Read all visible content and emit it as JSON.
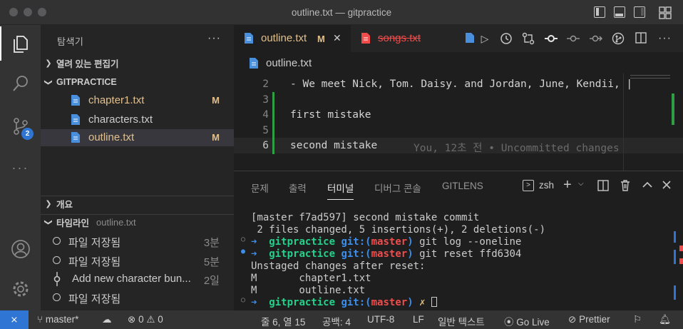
{
  "window": {
    "title": "outline.txt — gitpractice"
  },
  "activity": {
    "scm_badge": "2"
  },
  "sidebar": {
    "title": "탐색기",
    "more": "···",
    "open_editors": "열려 있는 편집기",
    "folder": "GITPRACTICE",
    "files": [
      {
        "name": "chapter1.txt",
        "status": "M"
      },
      {
        "name": "characters.txt",
        "status": ""
      },
      {
        "name": "outline.txt",
        "status": "M"
      }
    ],
    "outline_section": "개요",
    "timeline_section": "타임라인",
    "timeline_file": "outline.txt",
    "timeline": [
      {
        "label": "파일 저장됨",
        "time": "3분"
      },
      {
        "label": "파일 저장됨",
        "time": "5분"
      },
      {
        "label": "Add new character bun...",
        "time": "2일"
      },
      {
        "label": "파일 저장됨",
        "time": ""
      }
    ]
  },
  "tabs": [
    {
      "name": "outline.txt",
      "status": "M",
      "close": "✕"
    },
    {
      "name": "songs.txt"
    }
  ],
  "breadcrumb": {
    "file": "outline.txt"
  },
  "editor": {
    "lines": [
      {
        "num": "2",
        "text": "- We meet Nick, Tom. Daisy. and Jordan, June, Kendii, |"
      },
      {
        "num": "3",
        "text": ""
      },
      {
        "num": "4",
        "text": "first mistake"
      },
      {
        "num": "5",
        "text": ""
      },
      {
        "num": "6",
        "text": "second mistake"
      }
    ],
    "blame": "You, 12초 전 • Uncommitted changes"
  },
  "panel": {
    "tabs": [
      "문제",
      "출력",
      "터미널",
      "디버그 콘솔",
      "GITLENS"
    ],
    "active_tab": "터미널",
    "shell": "zsh",
    "terminal": {
      "line1": "[master f7ad597] second mistake commit",
      "line2": " 2 files changed, 5 insertions(+), 2 deletions(-)",
      "prompt_dir": "gitpractice",
      "prompt_git": "git:(",
      "prompt_branch": "master",
      "prompt_close": ")",
      "cmd1": "git log --oneline",
      "cmd2": "git reset ffd6304",
      "line5": "Unstaged changes after reset:",
      "line6": "M       chapter1.txt",
      "line7": "M       outline.txt",
      "dirty": "✗"
    }
  },
  "statusbar": {
    "branch": "master*",
    "errors": "0",
    "warnings": "0",
    "position": "줄 6, 열 15",
    "spaces": "공백: 4",
    "encoding": "UTF-8",
    "eol": "LF",
    "language": "일반 텍스트",
    "golive": "Go Live",
    "prettier": "Prettier"
  },
  "colors": {
    "accent": "#2f75d3",
    "modified": "#e2c08d",
    "deleted": "#f14c4c",
    "added_gutter": "#2ea043"
  }
}
